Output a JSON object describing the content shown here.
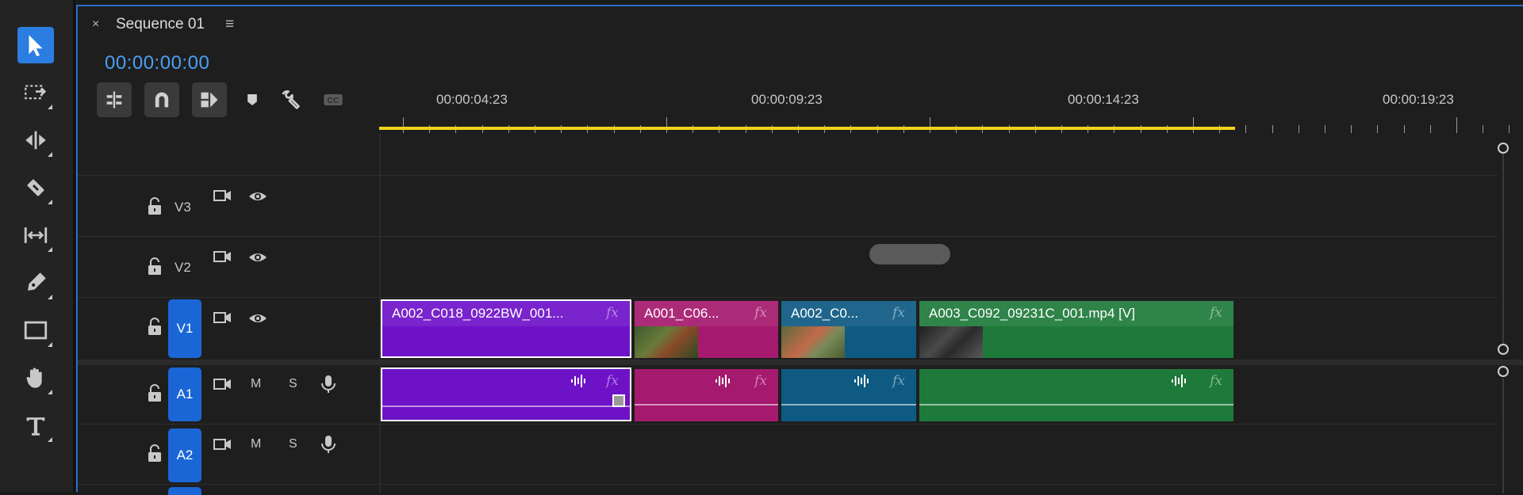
{
  "tools": [
    {
      "name": "selection-tool",
      "icon": "arrow-pointer-icon",
      "active": true
    },
    {
      "name": "track-select-tool",
      "icon": "track-select-icon",
      "active": false
    },
    {
      "name": "ripple-edit-tool",
      "icon": "ripple-edit-icon",
      "active": false
    },
    {
      "name": "razor-tool",
      "icon": "razor-icon",
      "active": false
    },
    {
      "name": "slip-tool",
      "icon": "slip-icon",
      "active": false
    },
    {
      "name": "pen-tool",
      "icon": "pen-icon",
      "active": false
    },
    {
      "name": "rectangle-tool",
      "icon": "rectangle-icon",
      "active": false
    },
    {
      "name": "hand-tool",
      "icon": "hand-icon",
      "active": false
    },
    {
      "name": "type-tool",
      "icon": "type-icon",
      "active": false
    }
  ],
  "panel": {
    "close": "×",
    "title": "Sequence 01",
    "menu": "≡",
    "timecode": "00:00:00:00"
  },
  "controls": [
    {
      "name": "insert-nest-button",
      "icon": "nest-icon"
    },
    {
      "name": "snap-button",
      "icon": "magnet-icon"
    },
    {
      "name": "linked-selection-button",
      "icon": "linked-selection-icon"
    },
    {
      "name": "add-marker-button",
      "icon": "marker-icon"
    },
    {
      "name": "timeline-settings-button",
      "icon": "wrench-icon"
    },
    {
      "name": "captions-button",
      "icon": "cc-icon"
    }
  ],
  "ruler": {
    "labels": [
      "00:00:04:23",
      "00:00:09:23",
      "00:00:14:23",
      "00:00:19:23"
    ]
  },
  "tracks": {
    "video": [
      {
        "id": "V3",
        "targeted": false
      },
      {
        "id": "V2",
        "targeted": false
      },
      {
        "id": "V1",
        "targeted": true
      }
    ],
    "audio": [
      {
        "id": "A1",
        "targeted": true,
        "mute": "M",
        "solo": "S"
      },
      {
        "id": "A2",
        "targeted": true,
        "mute": "M",
        "solo": "S"
      }
    ]
  },
  "clips": {
    "video": [
      {
        "label": "A002_C018_0922BW_001...",
        "fx": "fx",
        "color": "#6e12c8"
      },
      {
        "label": "A001_C06...",
        "fx": "fx",
        "color": "#a51a6e"
      },
      {
        "label": "A002_C0...",
        "fx": "fx",
        "color": "#0e5a83"
      },
      {
        "label": "A003_C092_09231C_001.mp4 [V]",
        "fx": "fx",
        "color": "#1e7a3a"
      }
    ],
    "audio": [
      {
        "fx": "fx",
        "color": "#6e12c8"
      },
      {
        "fx": "fx",
        "color": "#a51a6e"
      },
      {
        "fx": "fx",
        "color": "#0e5a83"
      },
      {
        "fx": "fx",
        "color": "#1e7a3a"
      }
    ]
  },
  "colors": {
    "accent": "#2b7de1",
    "timecode": "#4a9ff5",
    "workarea": "#f0d21c"
  }
}
